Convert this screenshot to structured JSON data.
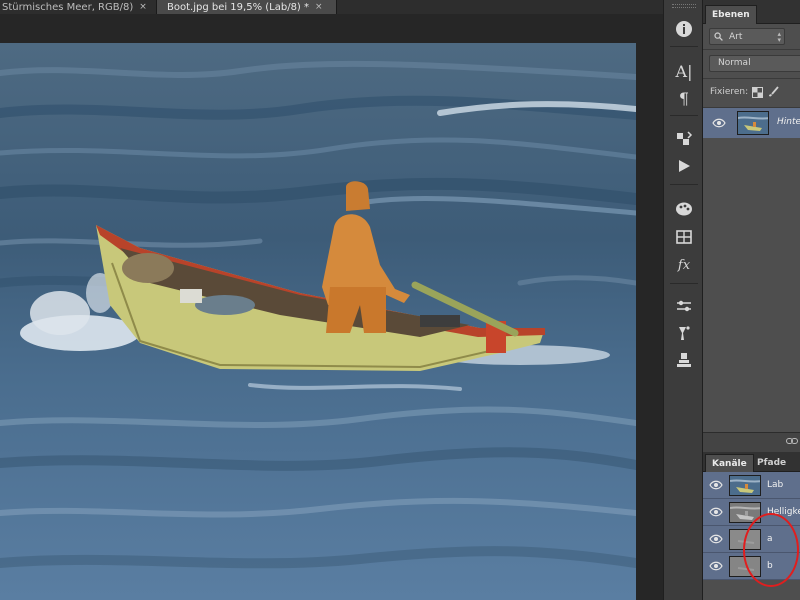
{
  "document_tabs": [
    {
      "label": "Stürmisches Meer, RGB/8)",
      "close": "×",
      "active": false
    },
    {
      "label": "Boot.jpg bei 19,5% (Lab/8) *",
      "close": "×",
      "active": true
    }
  ],
  "main": {
    "canvas": {
      "note": "Photo: orange-clad fisherman steering a yellow wooden boat through choppy blue sea"
    }
  },
  "toolbar": {
    "tools": [
      {
        "icon": "info-icon"
      },
      {
        "icon": "character-icon",
        "glyph": "A|"
      },
      {
        "icon": "paragraph-icon",
        "glyph": "¶"
      },
      {
        "icon": "history-icon"
      },
      {
        "icon": "actions-play-icon"
      },
      {
        "icon": "swatches-palette-icon"
      },
      {
        "icon": "styles-grid-icon"
      },
      {
        "icon": "fx-icon",
        "glyph": "fx"
      },
      {
        "icon": "adjustments-icon"
      },
      {
        "icon": "tool-presets-icon"
      },
      {
        "icon": "clone-source-icon"
      }
    ]
  },
  "layers_panel": {
    "tab_label": "Ebenen",
    "filter": {
      "icon": "search-icon",
      "value": "Art"
    },
    "blend_mode": "Normal",
    "lock_label": "Fixieren:",
    "layers": [
      {
        "name": "Hintergrund",
        "display_name": "Hinte",
        "visible": true
      }
    ]
  },
  "channels_panel": {
    "tabs": [
      {
        "label": "Kanäle",
        "active": true
      },
      {
        "label": "Pfade",
        "active": false
      }
    ],
    "channels": [
      {
        "name": "Lab",
        "visible": true
      },
      {
        "name": "Helligke",
        "visible": true
      },
      {
        "name": "a",
        "visible": true
      },
      {
        "name": "b",
        "visible": true
      }
    ]
  },
  "colors": {
    "selection_blue": "#5f6f8c",
    "annotation_red": "#e01e1e"
  }
}
